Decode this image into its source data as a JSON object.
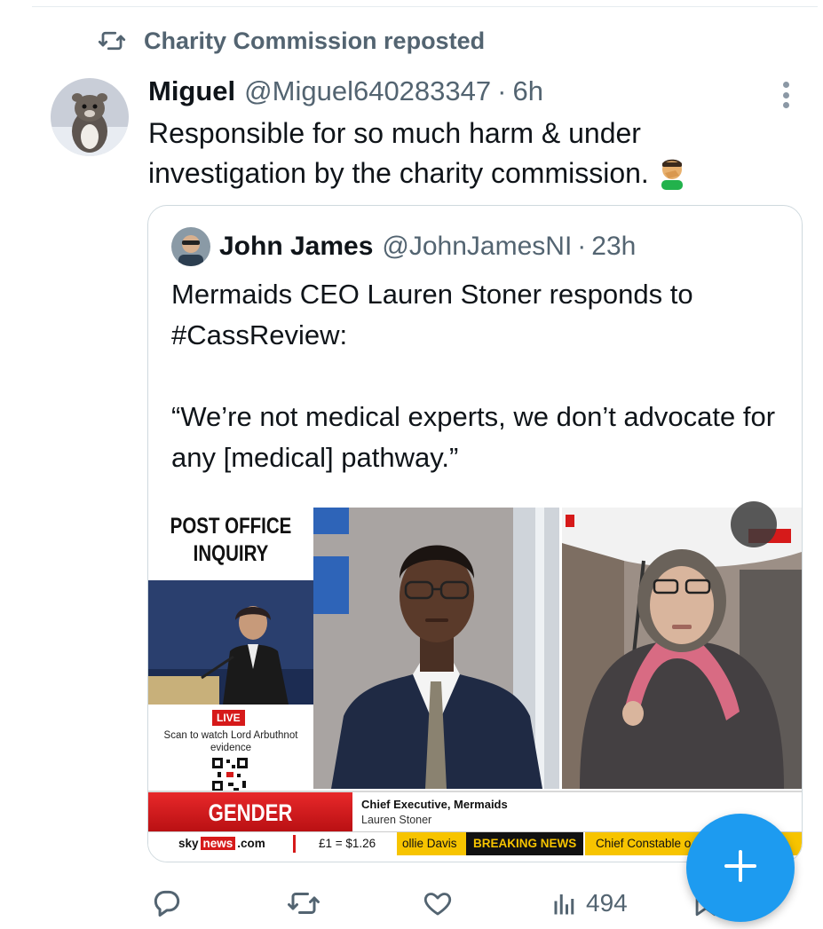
{
  "repost": {
    "label": "Charity Commission reposted",
    "icon": "repost-icon"
  },
  "post": {
    "author_name": "Miguel",
    "handle": "@Miguel640283347",
    "separator": "·",
    "time": "6h",
    "text": "Responsible for so much harm & under investigation by the charity commission.",
    "emoji": "man-facepalming-emoji"
  },
  "quote": {
    "author_name": "John James",
    "handle": "@JohnJamesNI",
    "separator": "·",
    "time": "23h",
    "text_line1": "Mermaids CEO Lauren Stoner responds to #CassReview:",
    "text_line2": "“We’re not medical experts, we don’t advocate for any [medical] pathway.”",
    "media": {
      "side_panel_title": "POST OFFICE INQUIRY",
      "live_badge": "LIVE",
      "scan_text": "Scan to watch Lord Arbuthnot evidence",
      "lower_third_title": "GENDER SERVICES",
      "lower_third_role": "Chief Executive, Mermaids",
      "lower_third_name": "Lauren Stoner",
      "ticker": {
        "logo_sky": "sky",
        "logo_news": "news",
        "logo_com": ".com",
        "rate": "£1 = $1.26",
        "names": "ollie Davis",
        "breaking": "BREAKING NEWS",
        "headline": "Chief Constable o"
      }
    }
  },
  "actions": {
    "reply": {
      "icon": "reply-icon"
    },
    "repost": {
      "icon": "repost-icon"
    },
    "like": {
      "icon": "heart-icon"
    },
    "views": {
      "icon": "views-icon",
      "count": "494"
    },
    "bookmark": {
      "icon": "bookmark-icon"
    }
  },
  "fab": {
    "icon": "plus-icon"
  },
  "colors": {
    "accent": "#1d9bf0",
    "muted": "#536471",
    "text": "#0f1419",
    "border": "#cfd9de",
    "sky_red": "#d61a1a",
    "ticker_yellow": "#f7c400"
  }
}
